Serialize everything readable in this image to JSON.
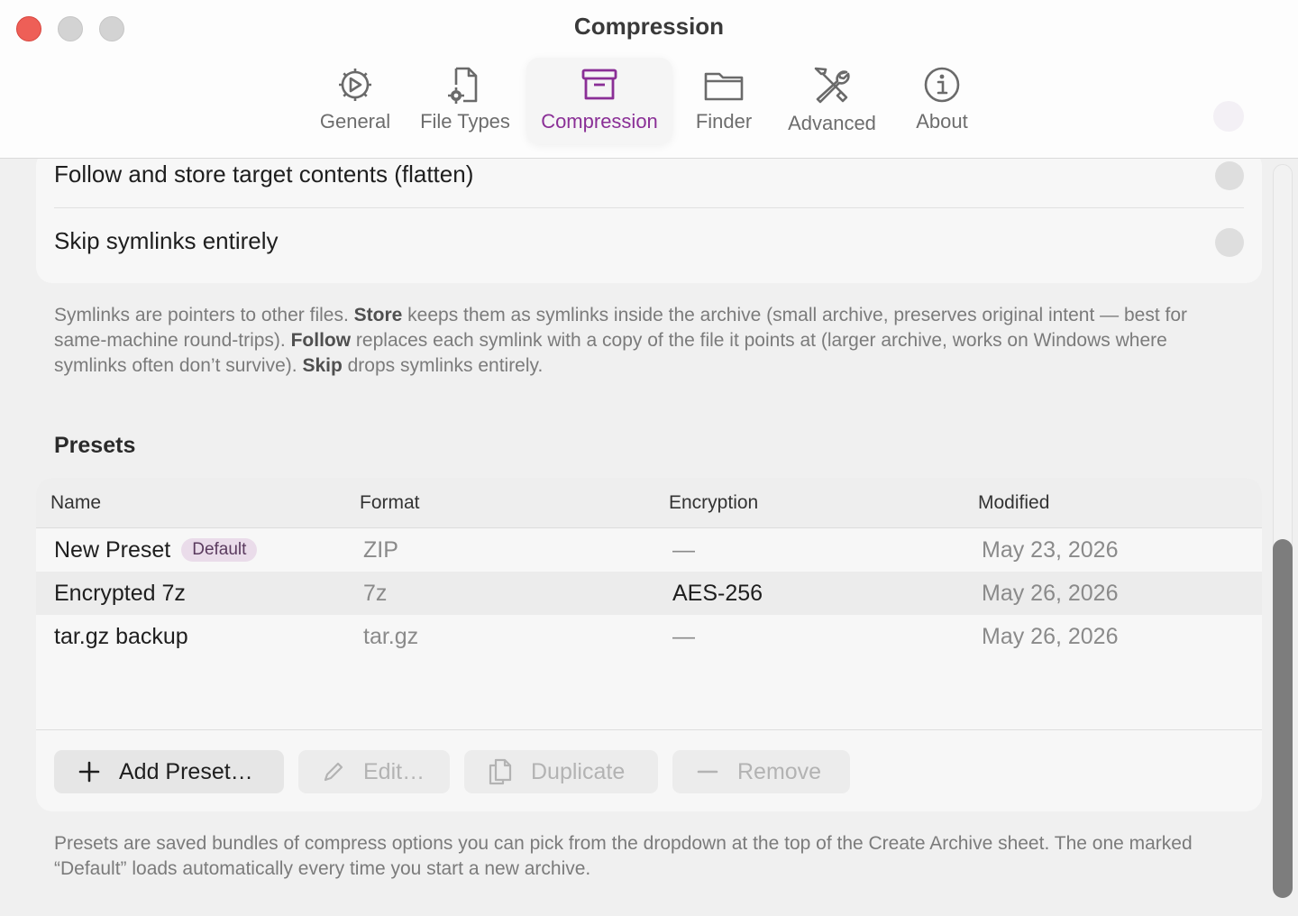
{
  "window": {
    "title": "Compression"
  },
  "tabs": [
    {
      "label": "General",
      "icon": "gear-icon"
    },
    {
      "label": "File Types",
      "icon": "document-gear-icon"
    },
    {
      "label": "Compression",
      "icon": "archive-box-icon",
      "active": true
    },
    {
      "label": "Finder",
      "icon": "folder-icon"
    },
    {
      "label": "Advanced",
      "icon": "wrench-screwdriver-icon"
    },
    {
      "label": "About",
      "icon": "info-icon"
    }
  ],
  "symlinks": {
    "follow_label": "Follow and store target contents (flatten)",
    "skip_label": "Skip symlinks entirely",
    "help_1": "Symlinks are pointers to other files. ",
    "help_store": "Store",
    "help_2": " keeps them as symlinks inside the archive (small archive, preserves original intent — best for same-machine round-trips). ",
    "help_follow": "Follow",
    "help_3": " replaces each symlink with a copy of the file it points at (larger archive, works on Windows where symlinks often don’t survive). ",
    "help_skip": "Skip",
    "help_4": " drops symlinks entirely."
  },
  "presets": {
    "title": "Presets",
    "columns": {
      "name": "Name",
      "format": "Format",
      "encryption": "Encryption",
      "modified": "Modified"
    },
    "rows": [
      {
        "name": "New Preset",
        "badge": "Default",
        "format": "ZIP",
        "encryption": "—",
        "modified": "May 23, 2026"
      },
      {
        "name": "Encrypted 7z",
        "format": "7z",
        "encryption": "AES-256",
        "modified": "May 26, 2026"
      },
      {
        "name": "tar.gz backup",
        "format": "tar.gz",
        "encryption": "—",
        "modified": "May 26, 2026"
      }
    ],
    "buttons": {
      "add": "Add Preset…",
      "edit": "Edit…",
      "duplicate": "Duplicate",
      "remove": "Remove"
    },
    "help": "Presets are saved bundles of compress options you can pick from the dropdown at the top of the Create Archive sheet. The one marked “Default” loads automatically every time you start a new archive."
  },
  "colors": {
    "accent": "#8a2f96",
    "close": "#ee5f57"
  }
}
